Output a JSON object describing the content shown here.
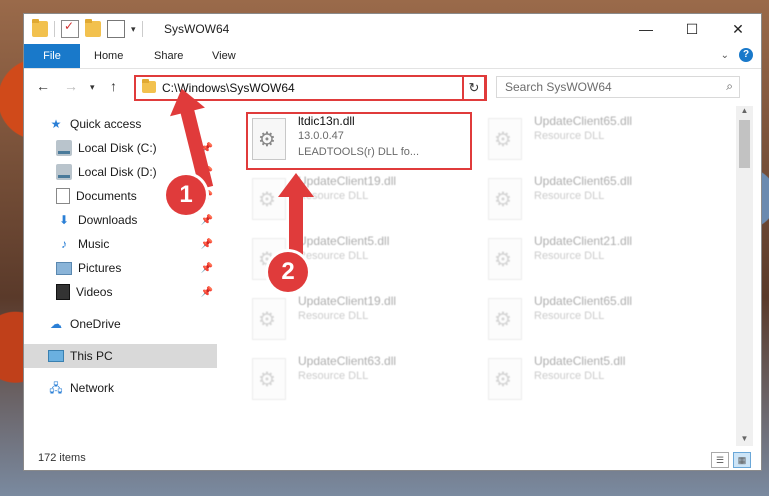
{
  "window": {
    "title": "SysWOW64",
    "buttons": {
      "minimize": "—",
      "maximize": "☐",
      "close": "✕"
    }
  },
  "ribbon": {
    "tabs": [
      "File",
      "Home",
      "Share",
      "View"
    ],
    "help": "?"
  },
  "navigation": {
    "address": "C:\\Windows\\SysWOW64",
    "search_placeholder": "Search SysWOW64"
  },
  "sidebar": {
    "items": [
      {
        "label": "Quick access",
        "icon": "star-icon"
      },
      {
        "label": "Local Disk (C:)",
        "icon": "drive-icon",
        "pinned": true
      },
      {
        "label": "Local Disk (D:)",
        "icon": "drive-icon",
        "pinned": true
      },
      {
        "label": "Documents",
        "icon": "documents-icon",
        "pinned": true
      },
      {
        "label": "Downloads",
        "icon": "downloads-icon",
        "pinned": true
      },
      {
        "label": "Music",
        "icon": "music-icon",
        "pinned": true
      },
      {
        "label": "Pictures",
        "icon": "pictures-icon",
        "pinned": true
      },
      {
        "label": "Videos",
        "icon": "videos-icon",
        "pinned": true
      },
      {
        "label": "OneDrive",
        "icon": "cloud-icon"
      },
      {
        "label": "This PC",
        "icon": "pc-icon",
        "selected": true
      },
      {
        "label": "Network",
        "icon": "network-icon"
      }
    ]
  },
  "files": [
    {
      "name": "ltdic13n.dll",
      "line2": "13.0.0.47",
      "line3": "LEADTOOLS(r) DLL fo...",
      "highlighted": true
    },
    {
      "name": "UpdateClient65.dll",
      "line2": "Resource DLL"
    },
    {
      "name": "UpdateClient19.dll",
      "line2": "Resource DLL"
    },
    {
      "name": "UpdateClient65.dll",
      "line2": "Resource DLL"
    },
    {
      "name": "UpdateClient5.dll",
      "line2": "Resource DLL"
    },
    {
      "name": "UpdateClient21.dll",
      "line2": "Resource DLL"
    },
    {
      "name": "UpdateClient19.dll",
      "line2": "Resource DLL"
    },
    {
      "name": "UpdateClient65.dll",
      "line2": "Resource DLL"
    },
    {
      "name": "UpdateClient63.dll",
      "line2": "Resource DLL"
    },
    {
      "name": "UpdateClient5.dll",
      "line2": "Resource DLL"
    }
  ],
  "status": {
    "count": "172 items"
  },
  "annotations": {
    "step1": "1",
    "step2": "2"
  },
  "colors": {
    "accent": "#1979ca",
    "highlight": "#e03b3b"
  }
}
